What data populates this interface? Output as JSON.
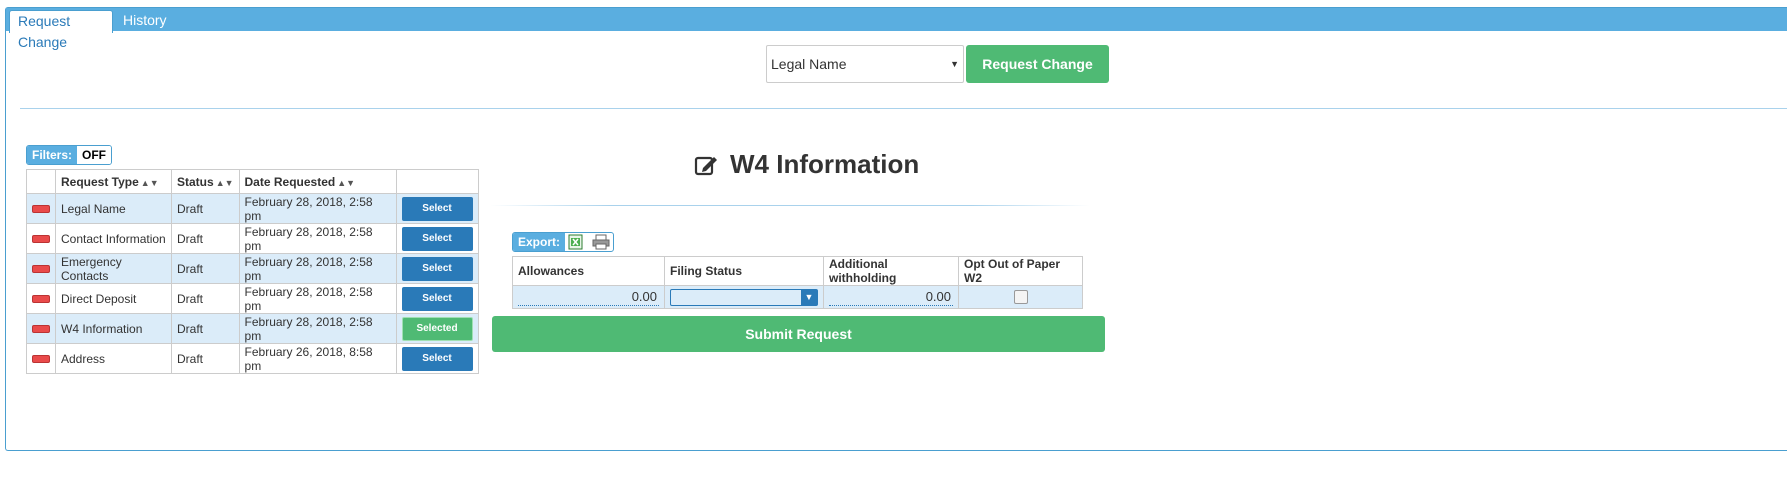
{
  "tabs": [
    {
      "label": "Request Change"
    },
    {
      "label": "History"
    }
  ],
  "request_type_select": {
    "value": "Legal Name"
  },
  "request_change_button": "Request Change",
  "filters": {
    "label": "Filters:",
    "value": "OFF"
  },
  "requests_table": {
    "headers": [
      "Request Type",
      "Status",
      "Date Requested"
    ],
    "rows": [
      {
        "type": "Legal Name",
        "status": "Draft",
        "date": "February 28, 2018, 2:58 pm",
        "action": "Select"
      },
      {
        "type": "Contact Information",
        "status": "Draft",
        "date": "February 28, 2018, 2:58 pm",
        "action": "Select"
      },
      {
        "type": "Emergency Contacts",
        "status": "Draft",
        "date": "February 28, 2018, 2:58 pm",
        "action": "Select"
      },
      {
        "type": "Direct Deposit",
        "status": "Draft",
        "date": "February 28, 2018, 2:58 pm",
        "action": "Select"
      },
      {
        "type": "W4 Information",
        "status": "Draft",
        "date": "February 28, 2018, 2:58 pm",
        "action": "Selected"
      },
      {
        "type": "Address",
        "status": "Draft",
        "date": "February 26, 2018, 8:58 pm",
        "action": "Select"
      }
    ]
  },
  "w4": {
    "title": "W4 Information",
    "export_label": "Export:",
    "headers": [
      "Allowances",
      "Filing Status",
      "Additional withholding",
      "Opt Out of Paper W2"
    ],
    "allowances": "0.00",
    "filing_status": "",
    "additional_withholding": "0.00"
  },
  "submit_button": "Submit Request",
  "colors": {
    "accent": "#5aaee0",
    "primary_button": "#2a7ab8",
    "success_button": "#4fba74",
    "row_highlight": "#dbecf9"
  }
}
